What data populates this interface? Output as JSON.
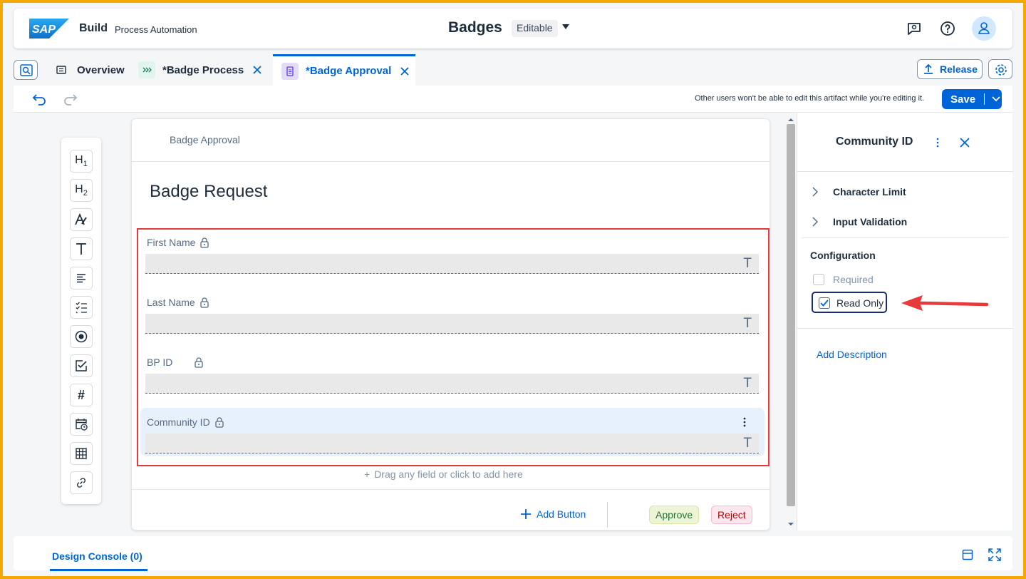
{
  "shell": {
    "logo_text": "SAP",
    "brand": "Build",
    "product": "Process Automation",
    "title": "Badges",
    "status": "Editable"
  },
  "tabs": [
    {
      "label": "Overview"
    },
    {
      "label": "*Badge Process"
    },
    {
      "label": "*Badge Approval"
    }
  ],
  "actions": {
    "release": "Release",
    "save": "Save",
    "edit_message": "Other users won't be able to edit this artifact while you're editing it."
  },
  "palette": [
    "H1",
    "H2",
    "A",
    "T",
    "paragraph",
    "checklist",
    "radio",
    "checkbox",
    "#",
    "date",
    "table",
    "link"
  ],
  "form": {
    "header": "Badge Approval",
    "title": "Badge Request",
    "fields": [
      {
        "label": "First Name"
      },
      {
        "label": "Last Name"
      },
      {
        "label": "BP ID"
      },
      {
        "label": "Community ID"
      }
    ],
    "input_type_glyph": "T",
    "drag_hint": "Drag any field or click to add here",
    "add_button": "Add Button",
    "approve": "Approve",
    "reject": "Reject"
  },
  "panel": {
    "title": "Community ID",
    "sections": [
      "Character Limit",
      "Input Validation"
    ],
    "configuration": "Configuration",
    "required": "Required",
    "read_only": "Read Only",
    "read_only_checked": true,
    "add_description": "Add Description"
  },
  "bottom": {
    "console": "Design Console (0)"
  },
  "colors": {
    "accent": "#0064d9",
    "highlight_border": "#e23b3b",
    "arrow": "#e8393b"
  }
}
